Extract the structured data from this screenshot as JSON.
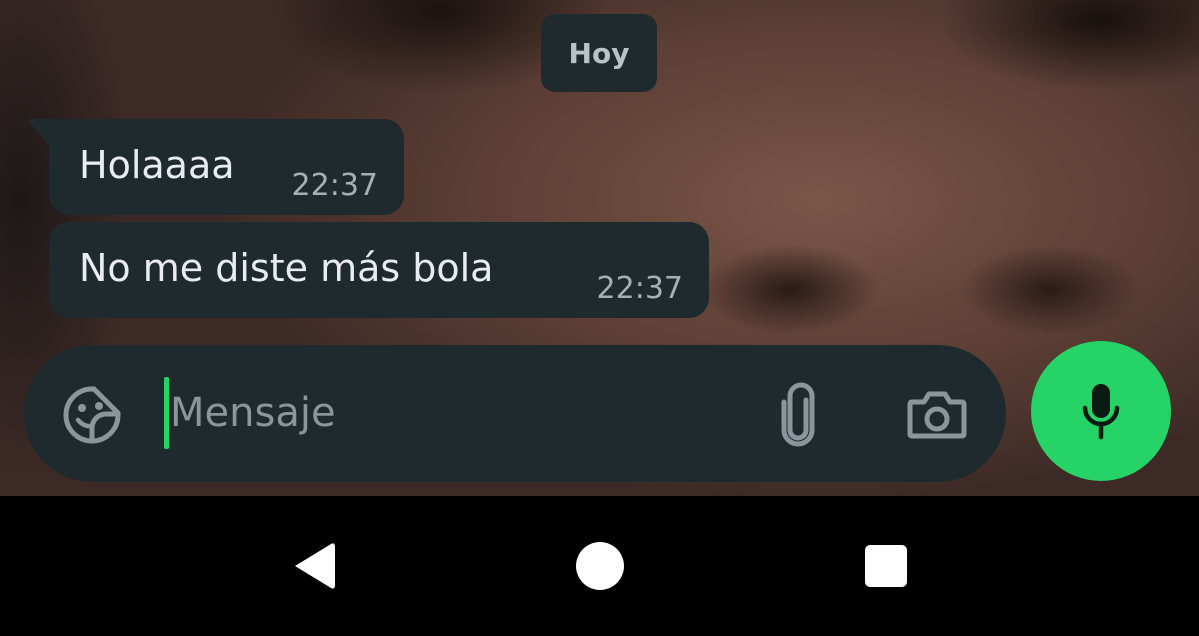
{
  "chat": {
    "date_chip": "Hoy",
    "messages": [
      {
        "text": "Holaaaa",
        "time": "22:37"
      },
      {
        "text": "No me diste más bola",
        "time": "22:37"
      }
    ]
  },
  "composer": {
    "placeholder": "Mensaje",
    "value": "",
    "icons": {
      "emoji": "sticker-emoji-icon",
      "attach": "paperclip-icon",
      "camera": "camera-icon",
      "mic": "microphone-icon"
    }
  },
  "navigation": {
    "icons": [
      "back-triangle-icon",
      "home-circle-icon",
      "recents-square-icon"
    ]
  },
  "colors": {
    "bubble": "#1f2a2e",
    "accent_green": "#25d366",
    "text_primary": "#e9edef",
    "text_secondary": "#a6b0b4"
  }
}
